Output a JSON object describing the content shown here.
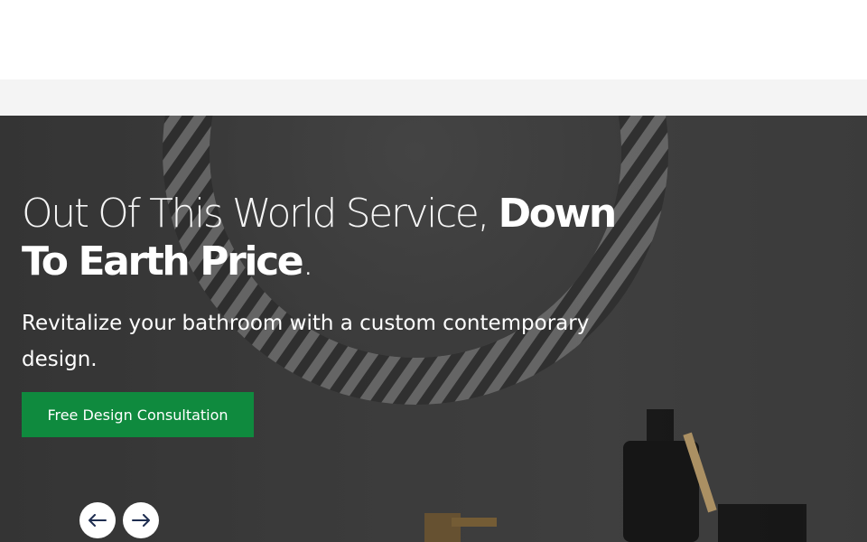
{
  "hero": {
    "headline_light": "Out Of This World Service, ",
    "headline_bold": "Down To Earth Price",
    "headline_end": ".",
    "subline": "Revitalize your bathroom with a custom contemporary design.",
    "cta_label": "Free Design Consultation"
  },
  "slider": {
    "prev_icon": "arrow-left-icon",
    "next_icon": "arrow-right-icon"
  },
  "colors": {
    "cta": "#0f8a3e",
    "overlay": "#3f3f3f"
  }
}
